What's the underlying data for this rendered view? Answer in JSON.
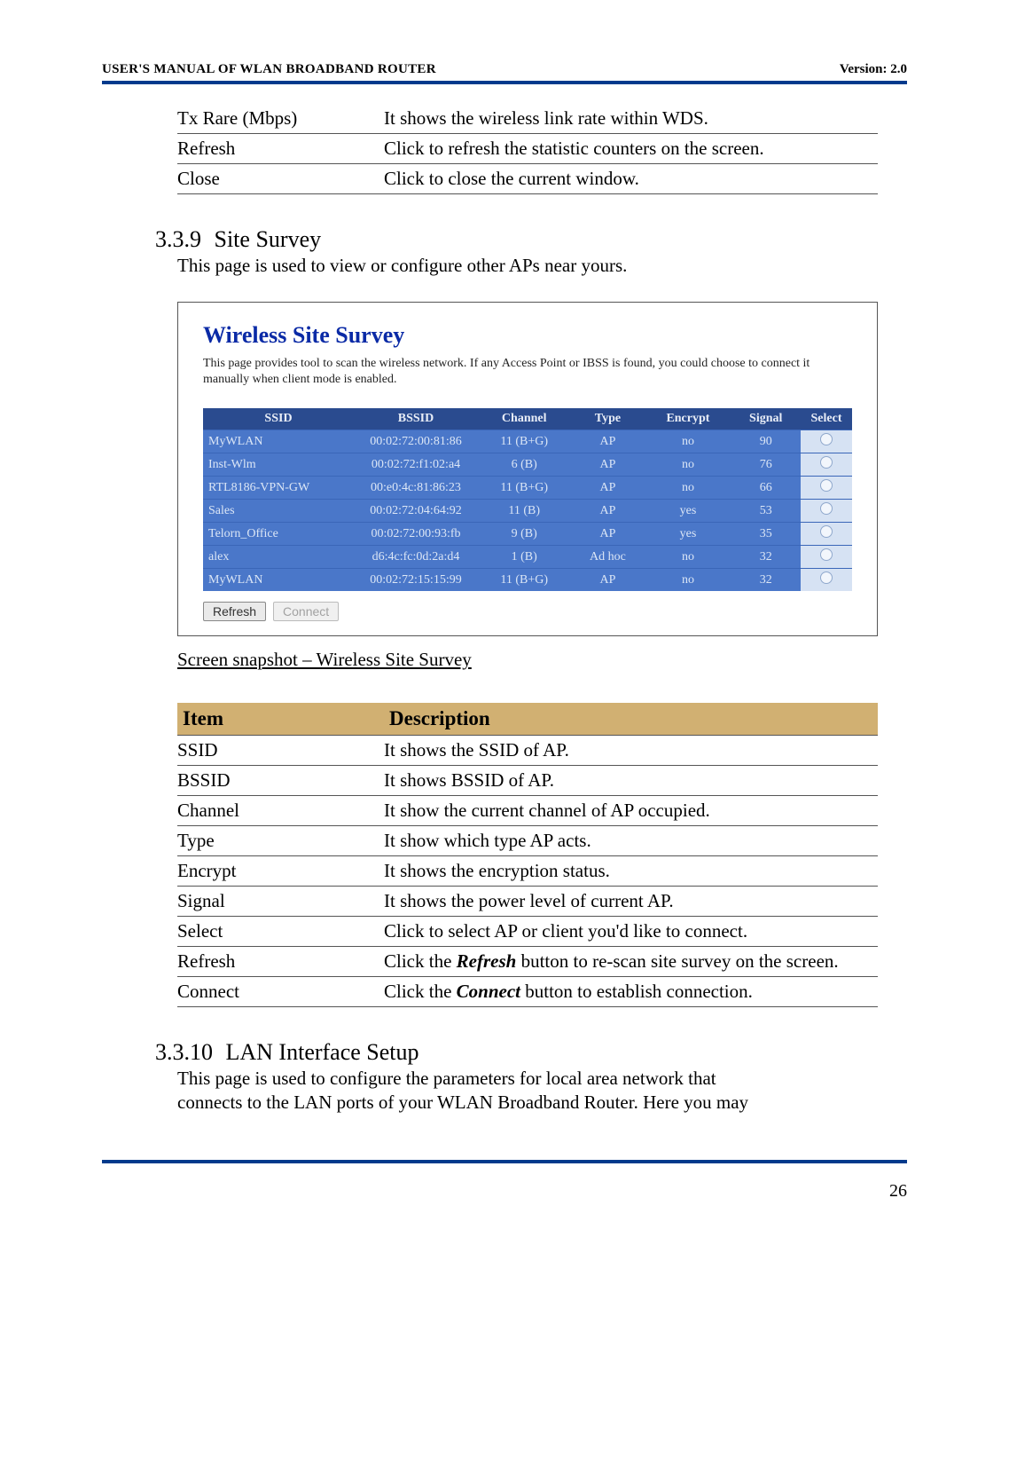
{
  "header": {
    "left": "USER'S MANUAL OF WLAN BROADBAND ROUTER",
    "right": "Version: 2.0"
  },
  "top_rows": [
    {
      "item": "Tx Rare (Mbps)",
      "desc": "It shows the wireless link rate within WDS."
    },
    {
      "item": "Refresh",
      "desc": "Click to refresh the statistic counters on the screen."
    },
    {
      "item": "Close",
      "desc": "Click to close the current window."
    }
  ],
  "section339": {
    "number": "3.3.9",
    "title": "Site Survey",
    "intro": "This page is used to view or configure other APs near yours."
  },
  "figure": {
    "title": "Wireless Site Survey",
    "desc": "This page provides tool to scan the wireless network. If any Access Point or IBSS is found, you could choose to connect it manually when client mode is enabled.",
    "headers": [
      "SSID",
      "BSSID",
      "Channel",
      "Type",
      "Encrypt",
      "Signal",
      "Select"
    ],
    "rows": [
      {
        "ssid": "MyWLAN",
        "bssid": "00:02:72:00:81:86",
        "channel": "11 (B+G)",
        "type": "AP",
        "encrypt": "no",
        "signal": "90"
      },
      {
        "ssid": "Inst-Wlm",
        "bssid": "00:02:72:f1:02:a4",
        "channel": "6 (B)",
        "type": "AP",
        "encrypt": "no",
        "signal": "76"
      },
      {
        "ssid": "RTL8186-VPN-GW",
        "bssid": "00:e0:4c:81:86:23",
        "channel": "11 (B+G)",
        "type": "AP",
        "encrypt": "no",
        "signal": "66"
      },
      {
        "ssid": "Sales",
        "bssid": "00:02:72:04:64:92",
        "channel": "11 (B)",
        "type": "AP",
        "encrypt": "yes",
        "signal": "53"
      },
      {
        "ssid": "Telorn_Office",
        "bssid": "00:02:72:00:93:fb",
        "channel": "9 (B)",
        "type": "AP",
        "encrypt": "yes",
        "signal": "35"
      },
      {
        "ssid": "alex",
        "bssid": "d6:4c:fc:0d:2a:d4",
        "channel": "1 (B)",
        "type": "Ad hoc",
        "encrypt": "no",
        "signal": "32"
      },
      {
        "ssid": "MyWLAN",
        "bssid": "00:02:72:15:15:99",
        "channel": "11 (B+G)",
        "type": "AP",
        "encrypt": "no",
        "signal": "32"
      }
    ],
    "btn_refresh": "Refresh",
    "btn_connect": "Connect"
  },
  "caption": "Screen snapshot – Wireless Site Survey",
  "desc_header": {
    "c1": "Item",
    "c2": "Description"
  },
  "desc_rows": [
    {
      "item": "SSID",
      "desc": "It shows the SSID of AP."
    },
    {
      "item": "BSSID",
      "desc": "It shows BSSID of AP."
    },
    {
      "item": "Channel",
      "desc": "It show the current channel of AP occupied."
    },
    {
      "item": "Type",
      "desc": "It show which type AP acts."
    },
    {
      "item": "Encrypt",
      "desc": "It shows the encryption status."
    },
    {
      "item": "Signal",
      "desc": "It shows the power level of current AP."
    },
    {
      "item": "Select",
      "desc": "Click to select AP or client you'd like to connect."
    },
    {
      "item": "Refresh",
      "desc_pre": "Click the ",
      "bold": "Refresh",
      "desc_post": " button to re-scan site survey on the screen."
    },
    {
      "item": "Connect",
      "desc_pre": "Click the ",
      "bold": "Connect",
      "desc_post": " button to establish connection."
    }
  ],
  "section3310": {
    "number": "3.3.10",
    "title": "LAN Interface Setup",
    "para1": "This page is used to configure the parameters for local area network that",
    "para2": "connects to the LAN ports of your WLAN Broadband Router. Here you may"
  },
  "page_number": "26"
}
